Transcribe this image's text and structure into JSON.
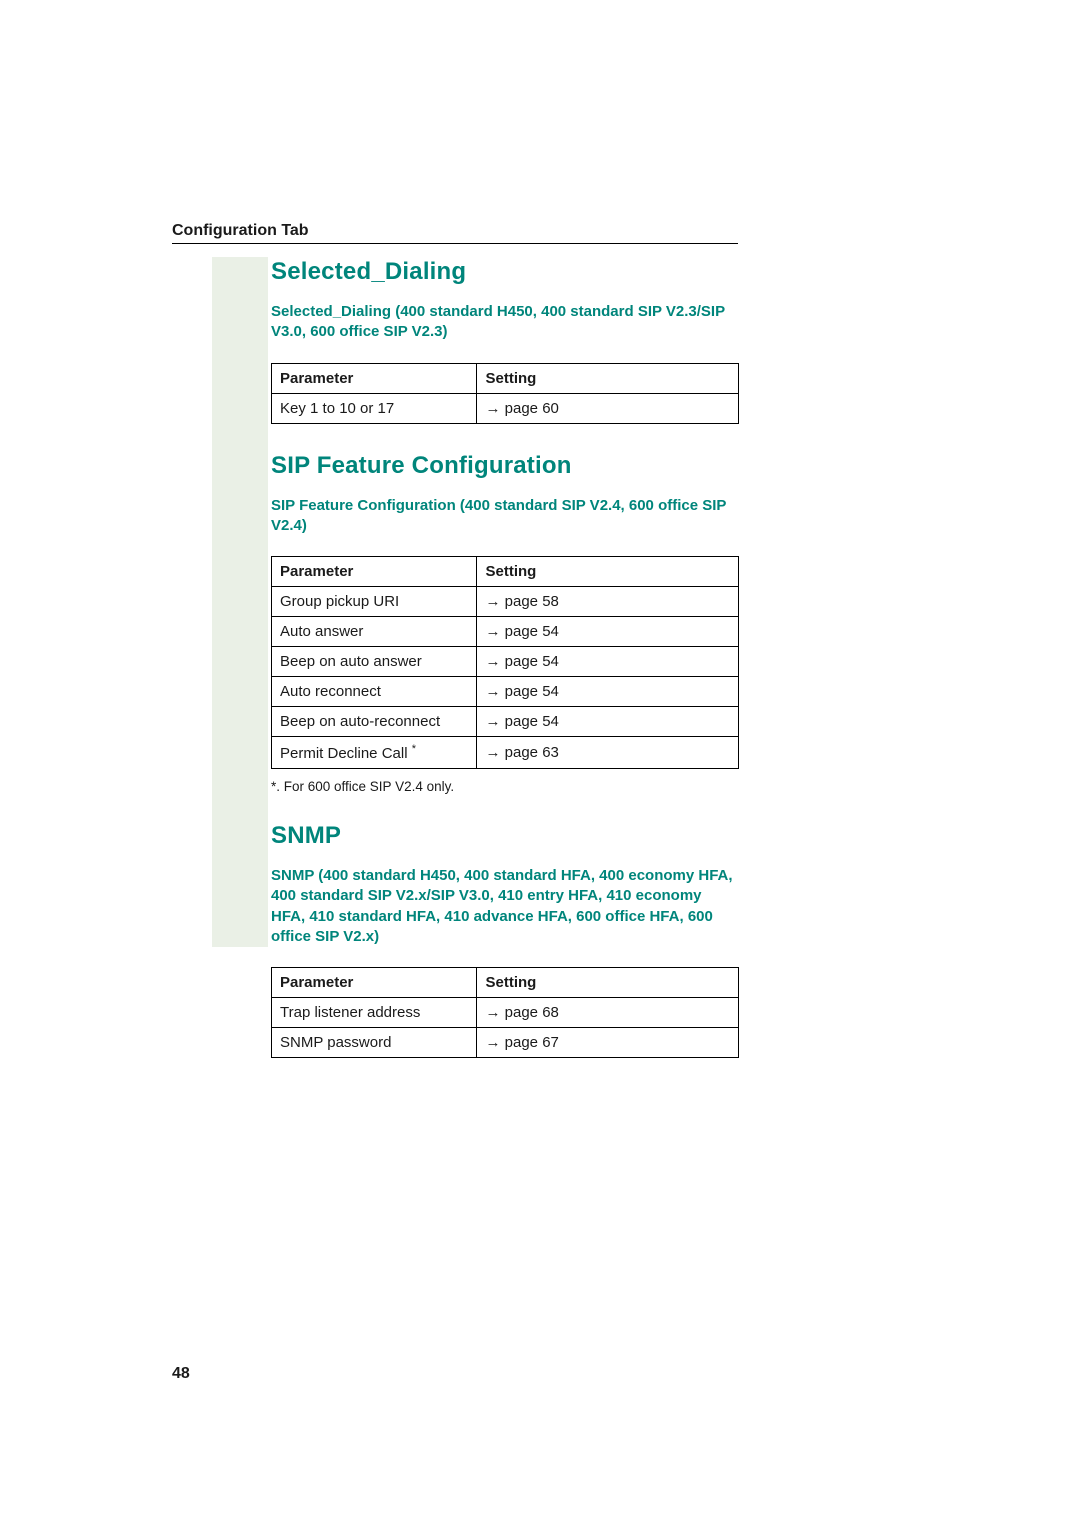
{
  "header": {
    "label": "Configuration Tab"
  },
  "page_number": "48",
  "arrow": "→",
  "sections": [
    {
      "title": "Selected_Dialing",
      "subtitle": "Selected_Dialing (400 standard H450, 400 standard SIP V2.3/SIP V3.0, 600 office SIP V2.3)",
      "table": {
        "headers": {
          "param": "Parameter",
          "setting": "Setting"
        },
        "rows": [
          {
            "param": "Key 1 to 10 or 17",
            "setting": "page 60"
          }
        ]
      }
    },
    {
      "title": "SIP Feature Configuration",
      "subtitle": "SIP Feature Configuration (400 standard SIP V2.4, 600 office SIP V2.4)",
      "table": {
        "headers": {
          "param": "Parameter",
          "setting": "Setting"
        },
        "rows": [
          {
            "param": "Group pickup URI",
            "setting": "page 58"
          },
          {
            "param": "Auto answer",
            "setting": "page 54"
          },
          {
            "param": "Beep on auto answer",
            "setting": "page 54"
          },
          {
            "param": "Auto reconnect",
            "setting": "page 54"
          },
          {
            "param": "Beep on auto-reconnect",
            "setting": "page 54"
          },
          {
            "param": "Permit Decline Call",
            "setting": "page 63",
            "starred": true
          }
        ]
      },
      "footnotes": [
        "*.   For 600 office SIP V2.4 only."
      ]
    },
    {
      "title": "SNMP",
      "subtitle": "SNMP (400 standard H450, 400 standard HFA, 400 economy HFA, 400 standard SIP V2.x/SIP V3.0, 410 entry HFA, 410 economy HFA, 410 standard HFA, 410 advance HFA, 600 office HFA, 600 office SIP V2.x)",
      "table": {
        "headers": {
          "param": "Parameter",
          "setting": "Setting"
        },
        "rows": [
          {
            "param": "Trap listener address",
            "setting": "page 68"
          },
          {
            "param": "SNMP password",
            "setting": "page 67"
          }
        ]
      }
    }
  ]
}
